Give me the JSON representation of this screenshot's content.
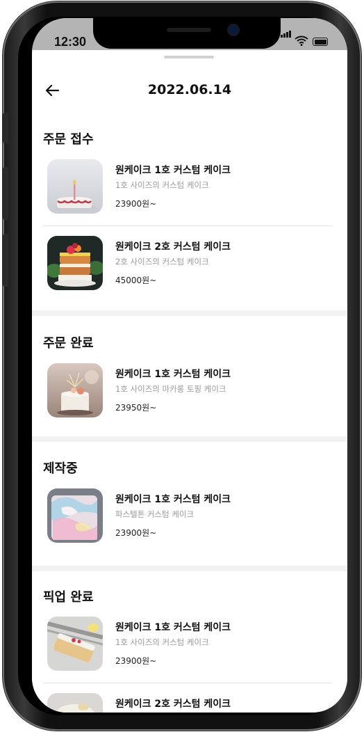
{
  "status_bar": {
    "time": "12:30",
    "signal_icon": "signal-icon",
    "wifi_icon": "wifi-icon",
    "battery_icon": "battery-icon"
  },
  "header": {
    "back_icon": "arrow-left-icon",
    "title": "2022.06.14"
  },
  "sections": [
    {
      "heading": "주문 접수",
      "items": [
        {
          "name": "원케이크 1호 커스텀 케이크",
          "desc": "1호 사이즈의 커스텀 케이크",
          "price": "23900원~"
        },
        {
          "name": "원케이크 2호 커스텀 케이크",
          "desc": "2호 사이즈의 커스텀 케이크",
          "price": "45000원~"
        }
      ]
    },
    {
      "heading": "주문 완료",
      "items": [
        {
          "name": "원케이크 1호 커스텀 케이크",
          "desc": "1호 사이즈의 마카롱 토핑 케이크",
          "price": "23950원~"
        }
      ]
    },
    {
      "heading": "제작중",
      "items": [
        {
          "name": "원케이크 1호 커스텀 케이크",
          "desc": "파스텔톤 커스텀 케이크",
          "price": "23900원~"
        }
      ]
    },
    {
      "heading": "픽업 완료",
      "items": [
        {
          "name": "원케이크 1호 커스텀 케이크",
          "desc": "1호 사이즈의 커스텀 케이크",
          "price": "23900원~"
        },
        {
          "name": "원케이크 2호 커스텀 케이크",
          "desc": "",
          "price": ""
        }
      ]
    }
  ]
}
